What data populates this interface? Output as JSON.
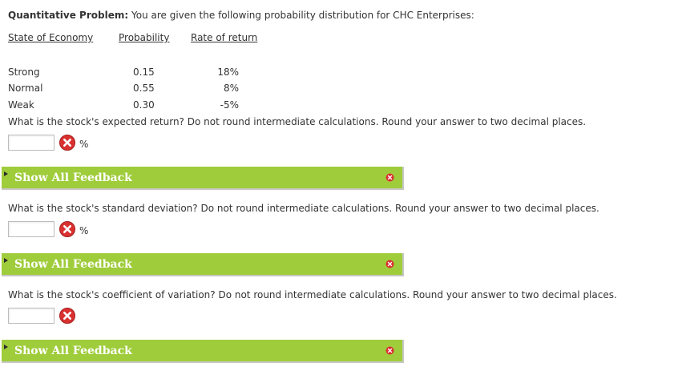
{
  "intro": {
    "bold": "Quantitative Problem:",
    "text": " You are given the following probability distribution for CHC Enterprises:"
  },
  "table": {
    "headers": [
      "State of Economy",
      "Probability",
      "Rate of return"
    ],
    "rows": [
      [
        "Strong",
        "0.15",
        "18%"
      ],
      [
        "Normal",
        "0.55",
        "8%"
      ],
      [
        "Weak",
        "0.30",
        "-5%"
      ]
    ]
  },
  "questions": [
    {
      "text": "What is the stock's expected return? Do not round intermediate calculations. Round your answer to two decimal places.",
      "input_value": "",
      "unit": "%",
      "feedback_label": "Show All Feedback"
    },
    {
      "text": "What is the stock's standard deviation? Do not round intermediate calculations. Round your answer to two decimal places.",
      "input_value": "",
      "unit": "%",
      "feedback_label": "Show All Feedback"
    },
    {
      "text": "What is the stock's coefficient of variation? Do not round intermediate calculations. Round your answer to two decimal places.",
      "input_value": "",
      "unit": "",
      "feedback_label": "Show All Feedback"
    }
  ],
  "icons": {
    "incorrect": "incorrect-x-icon",
    "close": "close-circle-icon",
    "expand": "triangle-right-icon"
  },
  "colors": {
    "feedback_bar": "#9fcc3b",
    "error_red": "#d93030",
    "text": "#333333"
  }
}
